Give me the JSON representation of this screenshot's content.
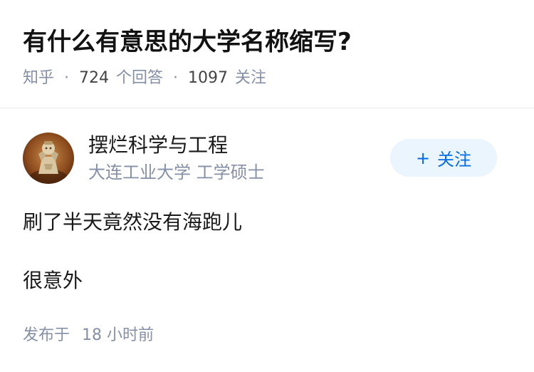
{
  "question": {
    "title": "有什么有意思的大学名称缩写?",
    "source": "知乎",
    "answer_count": "724",
    "answer_label": "个回答",
    "follower_count": "1097",
    "follower_label": "关注"
  },
  "answer": {
    "author": {
      "name": "摆烂科学与工程",
      "headline": "大连工业大学 工学硕士",
      "avatar_icon": "figurine-avatar-icon"
    },
    "follow_button": {
      "icon": "+",
      "label": "关注",
      "color": "#056de8",
      "background": "#ebf5fd"
    },
    "paragraphs": [
      "刷了半天竟然没有海跑儿",
      "很意外"
    ],
    "publish_label": "发布于",
    "publish_time": "18 小时前"
  }
}
